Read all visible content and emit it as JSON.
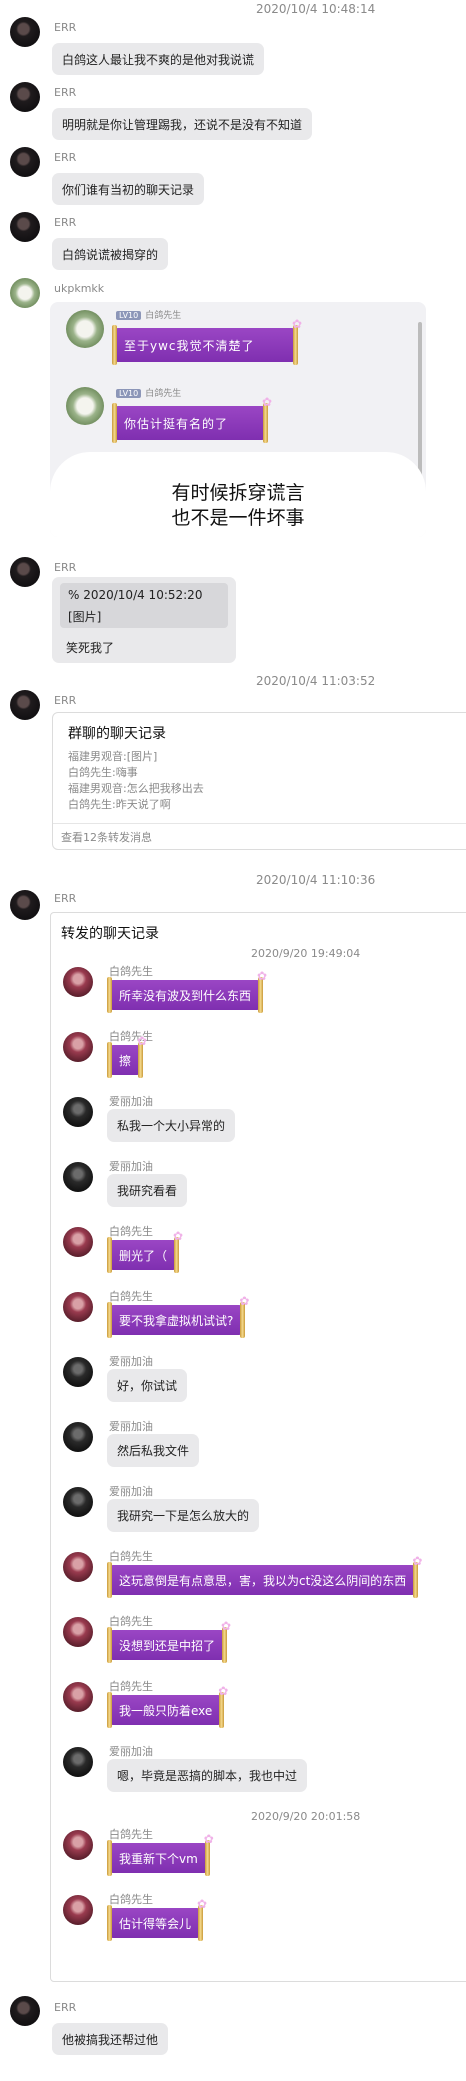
{
  "top_time": "2020/10/4 10:48:14",
  "messages_a": [
    {
      "name": "ERR",
      "text": "白鸽这人最让我不爽的是他对我说谎"
    },
    {
      "name": "ERR",
      "text": "明明就是你让管理踢我，还说不是没有不知道"
    },
    {
      "name": "ERR",
      "text": "你们谁有当初的聊天记录"
    },
    {
      "name": "ERR",
      "text": "白鸽说谎被揭穿的"
    }
  ],
  "uk": {
    "name": "ukpkmkk",
    "img": {
      "rows": [
        {
          "tag": "LV10",
          "sender": "白鸽先生",
          "text": "至于ywc我觉不清楚了"
        },
        {
          "tag": "LV10",
          "sender": "白鸽先生",
          "text": "你估计挺有名的了"
        }
      ],
      "caption": [
        "有时候拆穿谎言",
        "也不是一件坏事"
      ]
    }
  },
  "quote_msg": {
    "name": "ERR",
    "quote_line1": "%  2020/10/4 10:52:20",
    "quote_line2": "[图片]",
    "text": "笑死我了"
  },
  "time2": "2020/10/4 11:03:52",
  "fwd1": {
    "name": "ERR",
    "title": "群聊的聊天记录",
    "lines": [
      "福建男观音:[图片]",
      "白鸽先生:嗨事",
      "福建男观音:怎么把我移出去",
      "白鸽先生:昨天说了啊"
    ],
    "footer": "查看12条转发消息"
  },
  "time3": "2020/10/4 11:10:36",
  "fwd2": {
    "name": "ERR",
    "title": "转发的聊天记录",
    "time_a": "2020/9/20 19:49:04",
    "time_b": "2020/9/20 20:01:58",
    "items": [
      {
        "who": "白鸽先生",
        "type": "p",
        "text": "所幸没有波及到什么东西"
      },
      {
        "who": "白鸽先生",
        "type": "p",
        "text": "擦"
      },
      {
        "who": "爱丽加油",
        "type": "g",
        "text": "私我一个大小异常的"
      },
      {
        "who": "爱丽加油",
        "type": "g",
        "text": "我研究看看"
      },
      {
        "who": "白鸽先生",
        "type": "p",
        "text": "删光了（"
      },
      {
        "who": "白鸽先生",
        "type": "p",
        "text": "要不我拿虚拟机试试?"
      },
      {
        "who": "爱丽加油",
        "type": "g",
        "text": "好，你试试"
      },
      {
        "who": "爱丽加油",
        "type": "g",
        "text": "然后私我文件"
      },
      {
        "who": "爱丽加油",
        "type": "g",
        "text": "我研究一下是怎么放大的"
      },
      {
        "who": "白鸽先生",
        "type": "p",
        "text": "这玩意倒是有点意思，害，我以为ct没这么阴间的东西"
      },
      {
        "who": "白鸽先生",
        "type": "p",
        "text": "没想到还是中招了"
      },
      {
        "who": "白鸽先生",
        "type": "p",
        "text": "我一般只防着exe"
      },
      {
        "who": "爱丽加油",
        "type": "g",
        "text": "嗯，毕竟是恶搞的脚本，我也中过"
      },
      {
        "who": "白鸽先生",
        "type": "p",
        "text": "我重新下个vm"
      },
      {
        "who": "白鸽先生",
        "type": "p",
        "text": "估计得等会儿"
      }
    ]
  },
  "last": {
    "name": "ERR",
    "text": "他被搞我还帮过他"
  },
  "colors": {
    "purple": "#8a3bbd",
    "gray_bubble": "#e9e9eb"
  }
}
